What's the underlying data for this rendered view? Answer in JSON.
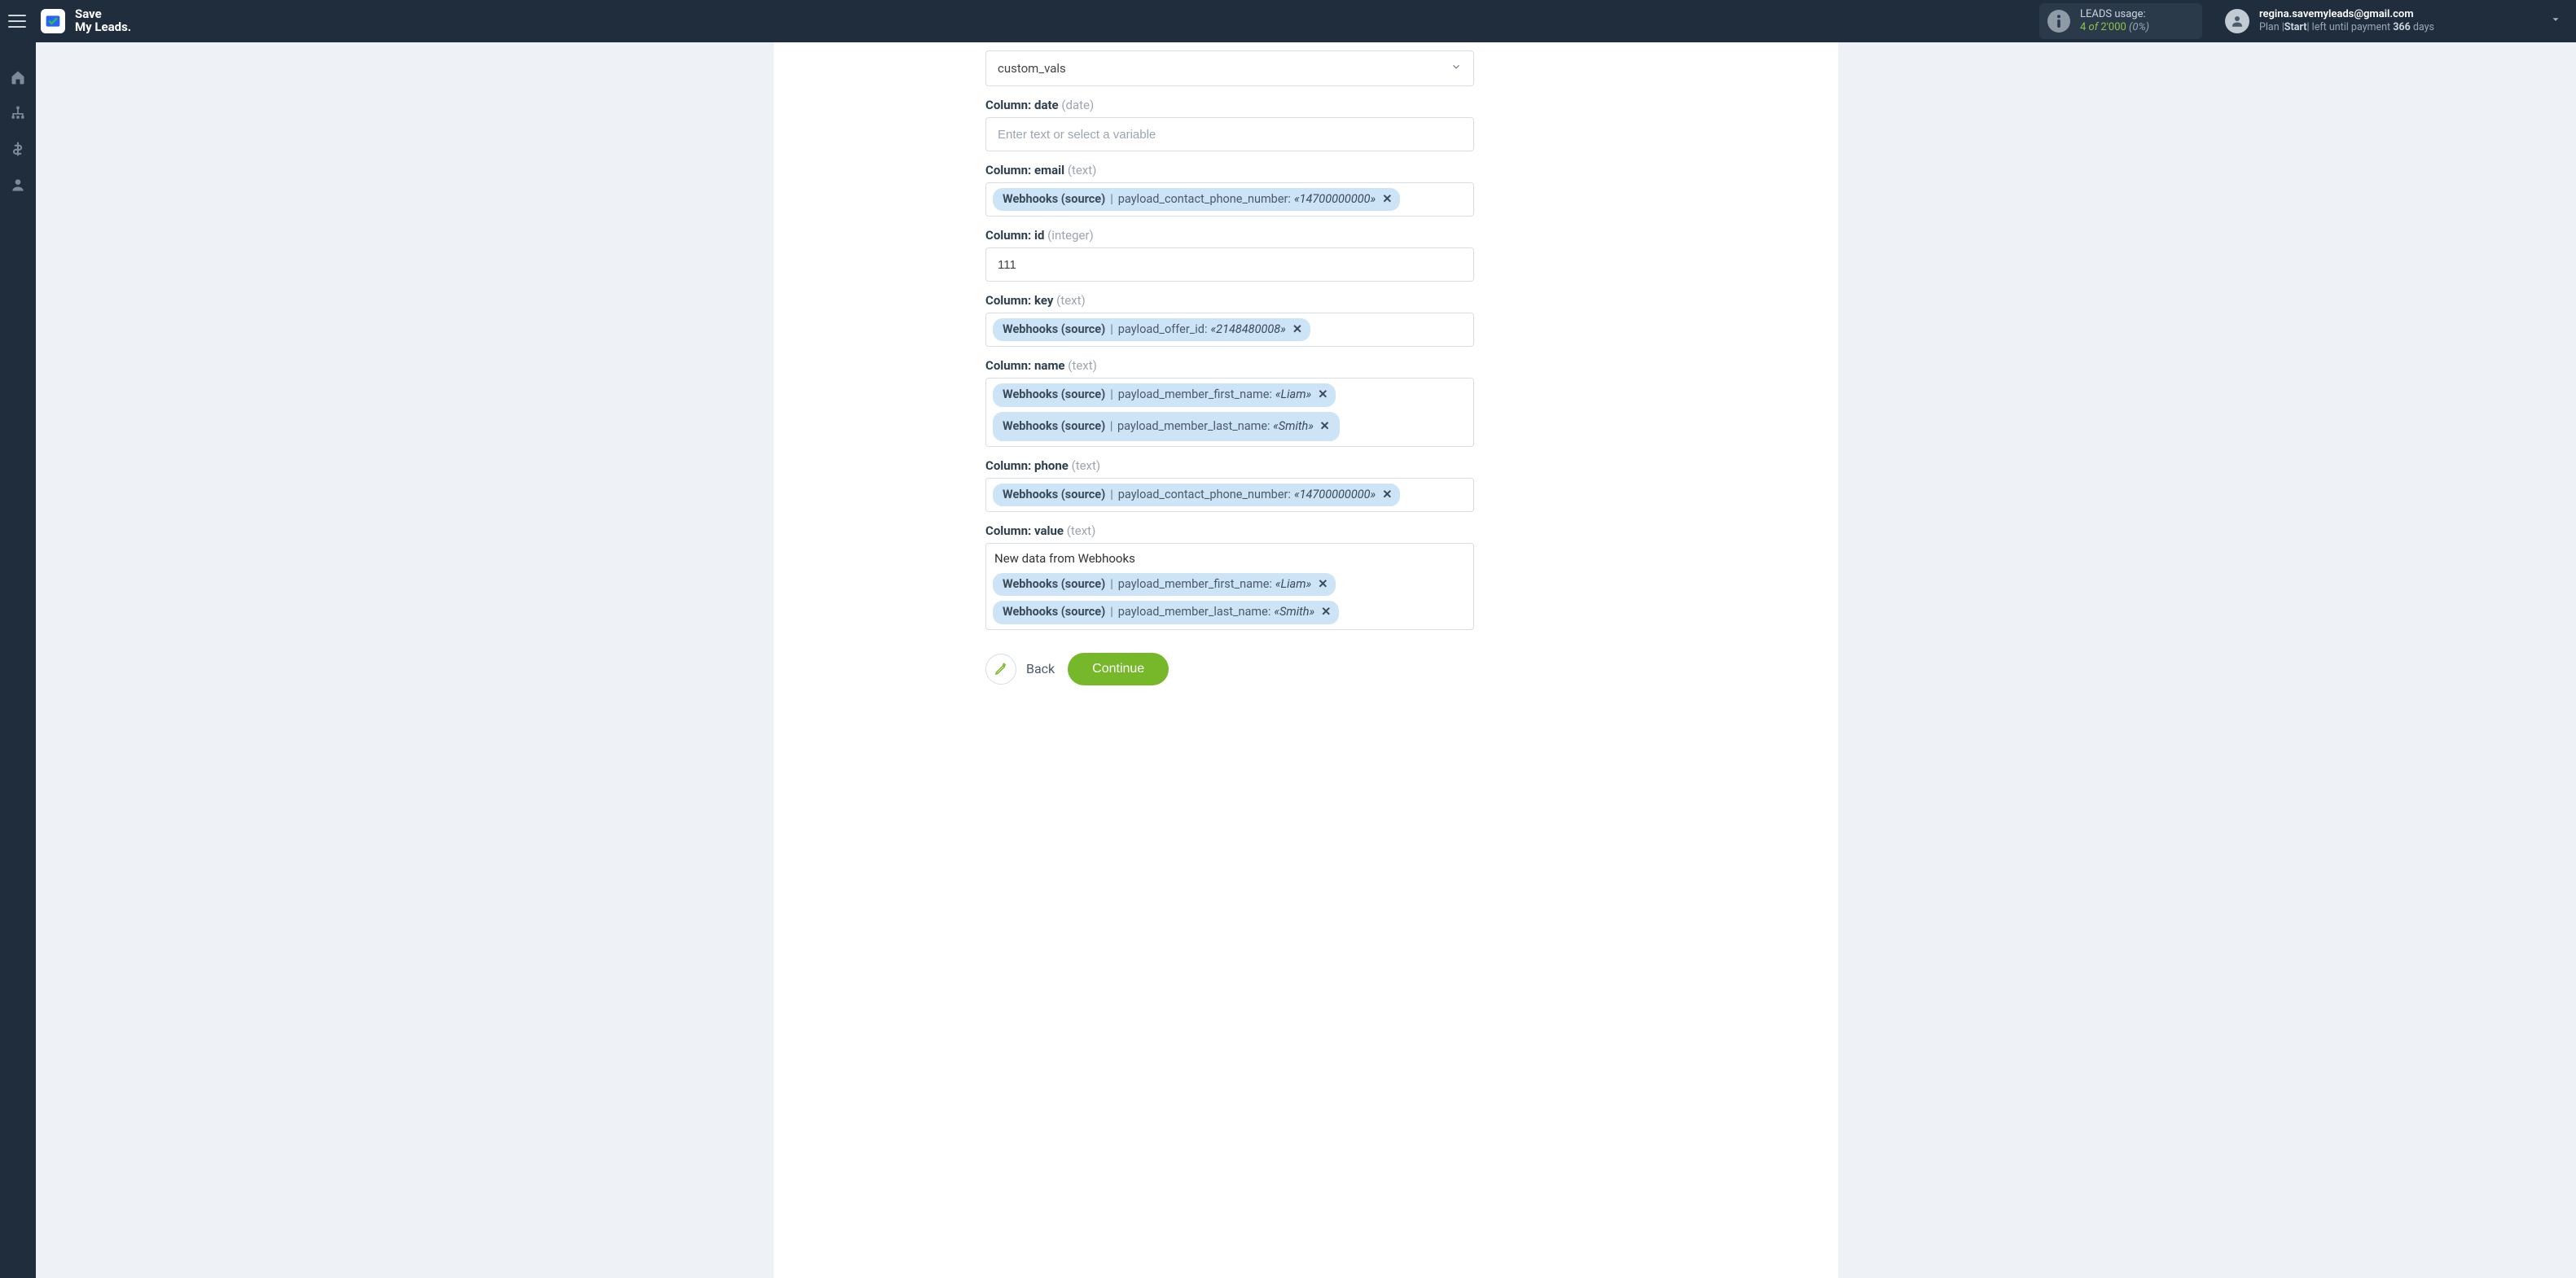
{
  "brand": {
    "line1": "Save",
    "line2": "My Leads."
  },
  "usage": {
    "title": "LEADS usage:",
    "used": "4",
    "of_word": "of",
    "total": "2'000",
    "pct": "(0%)"
  },
  "account": {
    "email": "regina.savemyleads@gmail.com",
    "plan_prefix": "Plan |",
    "plan_name": "Start",
    "plan_mid": "| left until payment ",
    "days": "366",
    "days_suffix": " days"
  },
  "select": {
    "value": "custom_vals"
  },
  "fields": {
    "date": {
      "label_bold": "Column: date",
      "label_hint": "(date)",
      "placeholder": "Enter text or select a variable"
    },
    "email": {
      "label_bold": "Column: email",
      "label_hint": "(text)"
    },
    "id": {
      "label_bold": "Column: id",
      "label_hint": "(integer)",
      "value": "111"
    },
    "key": {
      "label_bold": "Column: key",
      "label_hint": "(text)"
    },
    "name": {
      "label_bold": "Column: name",
      "label_hint": "(text)"
    },
    "phone": {
      "label_bold": "Column: phone",
      "label_hint": "(text)"
    },
    "value": {
      "label_bold": "Column: value",
      "label_hint": "(text)",
      "prefix_text": "New data from Webhooks"
    }
  },
  "tokens": {
    "source": "Webhooks (source)",
    "pipe": " | ",
    "close": "✕",
    "phone_field": "payload_contact_phone_number: ",
    "phone_val": "«14700000000»",
    "offer_field": "payload_offer_id: ",
    "offer_val": "«2148480008»",
    "first_field": "payload_member_first_name: ",
    "first_val": "«Liam»",
    "last_field": "payload_member_last_name: ",
    "last_val": "«Smith»"
  },
  "buttons": {
    "back": "Back",
    "continue": "Continue"
  }
}
